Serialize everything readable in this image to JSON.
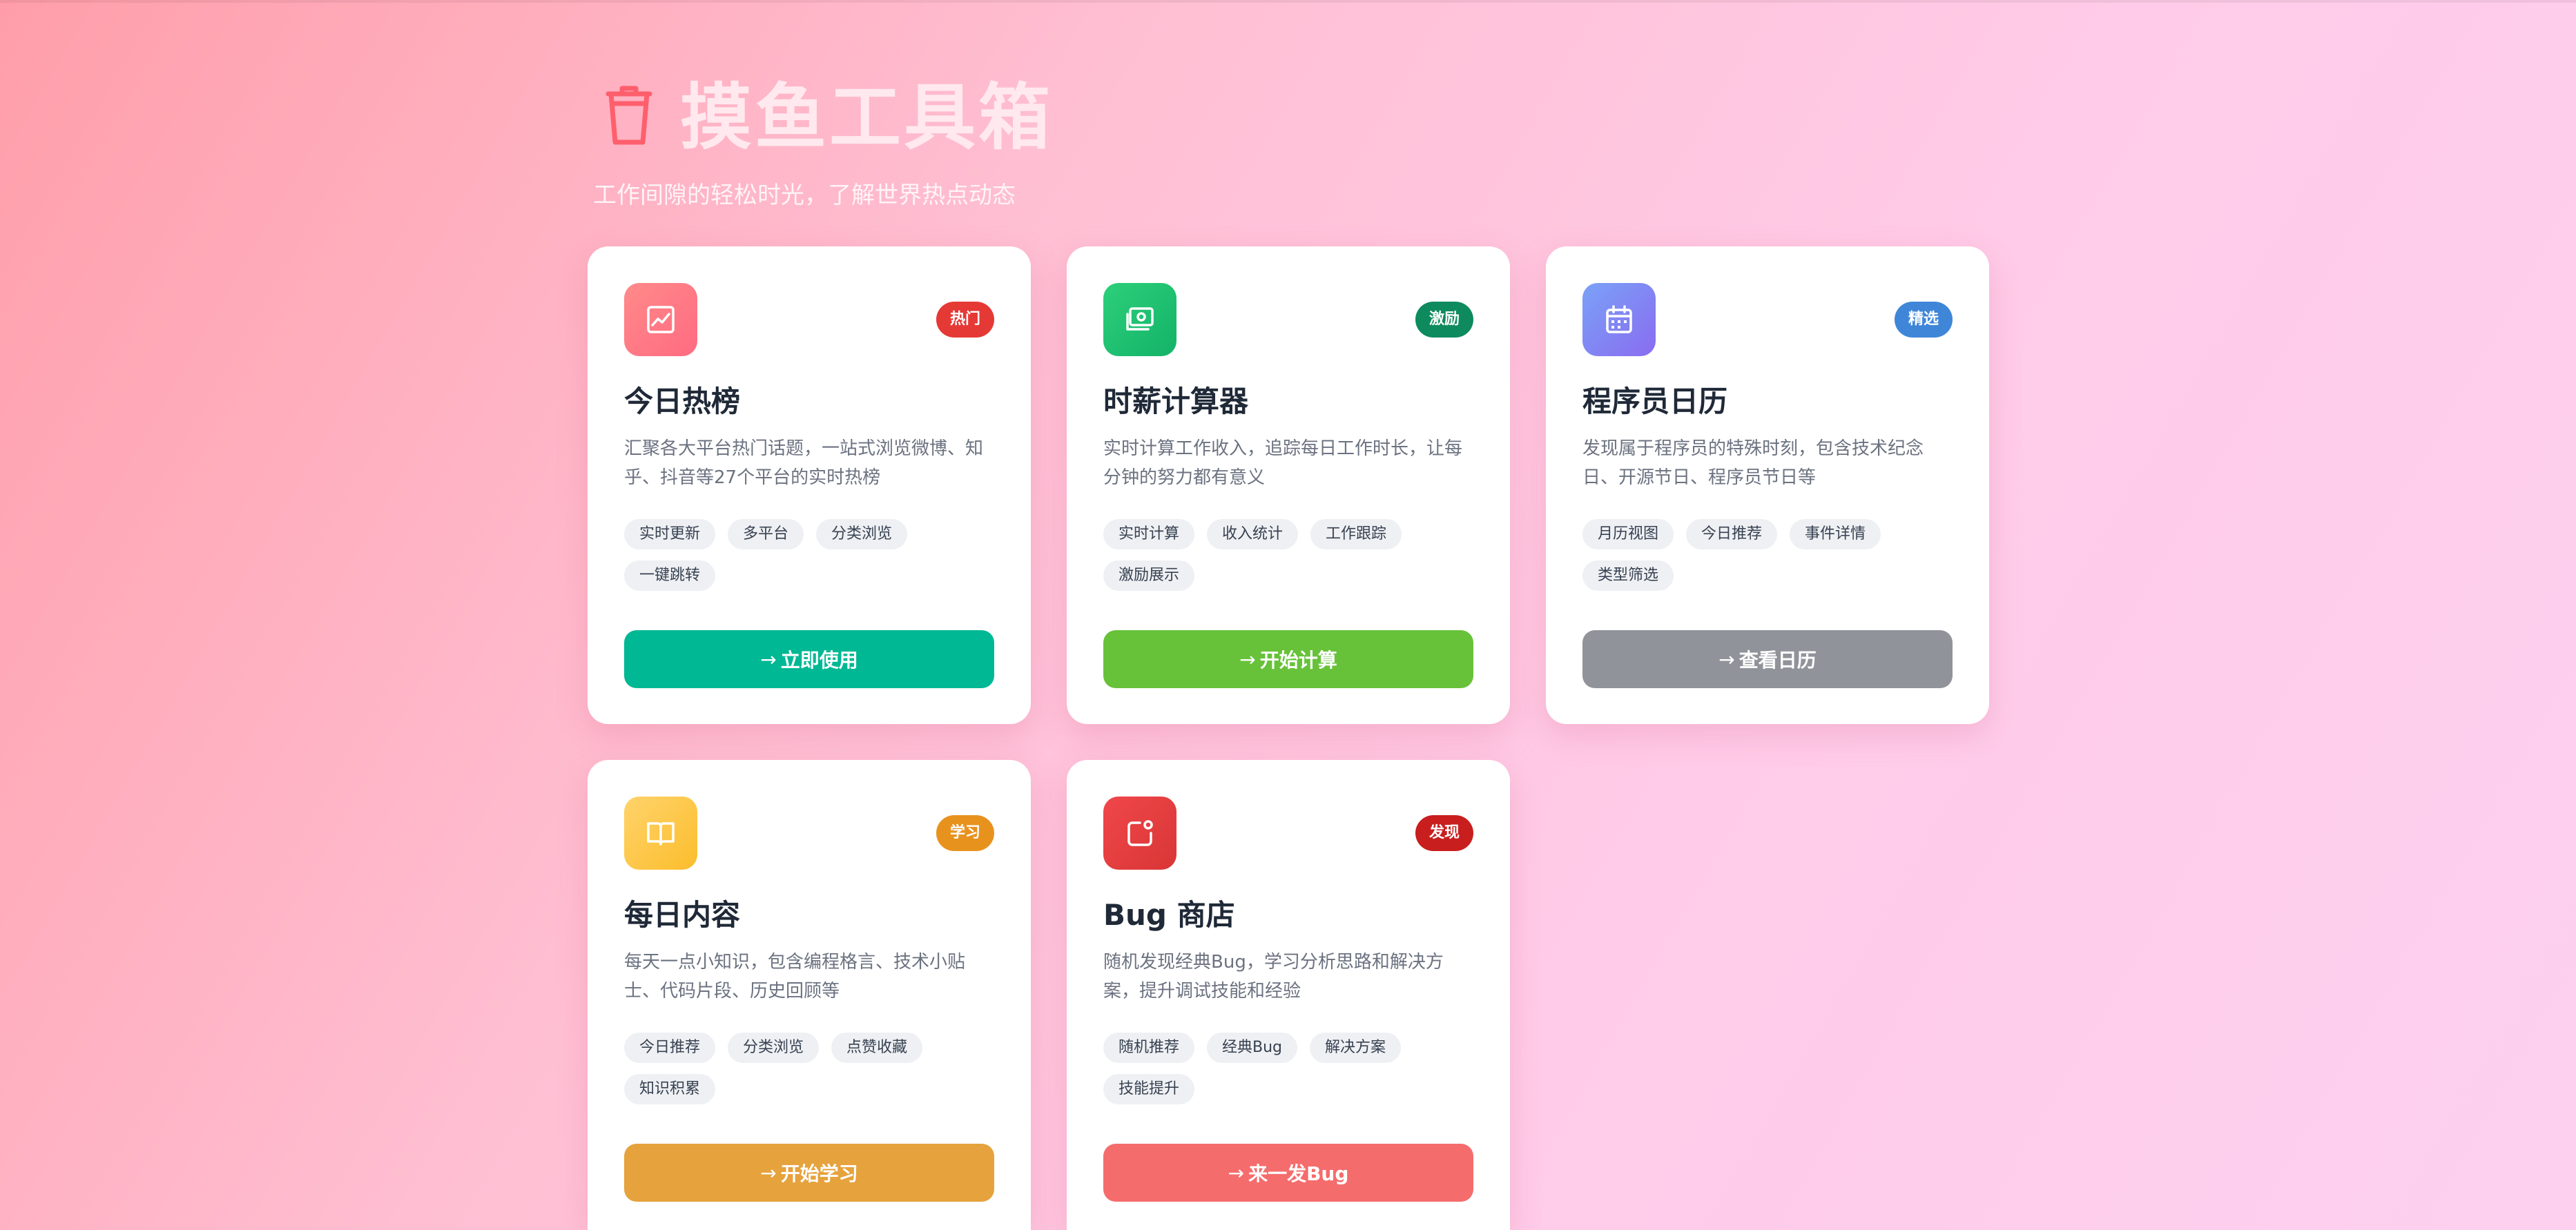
{
  "header": {
    "title": "摸鱼工具箱",
    "subtitle": "工作间隙的轻松时光，了解世界热点动态",
    "logo_icon": "cup-icon",
    "accent_color": "#ff5f6d"
  },
  "cards": [
    {
      "icon": "trending-chart-icon",
      "icon_color": "#ff7b7b",
      "badge": "热门",
      "badge_color": "#e53935",
      "title": "今日热榜",
      "description": "汇聚各大平台热门话题，一站式浏览微博、知乎、抖音等27个平台的实时热榜",
      "tags": [
        "实时更新",
        "多平台",
        "分类浏览",
        "一键跳转"
      ],
      "button_label": "立即使用",
      "button_color": "#00b894"
    },
    {
      "icon": "money-icon",
      "icon_color": "#1dc171",
      "badge": "激励",
      "badge_color": "#0e8a5f",
      "title": "时薪计算器",
      "description": "实时计算工作收入，追踪每日工作时长，让每分钟的努力都有意义",
      "tags": [
        "实时计算",
        "收入统计",
        "工作跟踪",
        "激励展示"
      ],
      "button_label": "开始计算",
      "button_color": "#67c23a"
    },
    {
      "icon": "calendar-icon",
      "icon_color": "#7f7cf0",
      "badge": "精选",
      "badge_color": "#3f86d8",
      "title": "程序员日历",
      "description": "发现属于程序员的特殊时刻，包含技术纪念日、开源节日、程序员节日等",
      "tags": [
        "月历视图",
        "今日推荐",
        "事件详情",
        "类型筛选"
      ],
      "button_label": "查看日历",
      "button_color": "#909399"
    },
    {
      "icon": "book-icon",
      "icon_color": "#fcc63d",
      "badge": "学习",
      "badge_color": "#e8921e",
      "title": "每日内容",
      "description": "每天一点小知识，包含编程格言、技术小贴士、代码片段、历史回顾等",
      "tags": [
        "今日推荐",
        "分类浏览",
        "点赞收藏",
        "知识积累"
      ],
      "button_label": "开始学习",
      "button_color": "#e6a23c"
    },
    {
      "icon": "notification-square-icon",
      "icon_color": "#e53e3e",
      "badge": "发现",
      "badge_color": "#c81e1e",
      "title": "Bug 商店",
      "description": "随机发现经典Bug，学习分析思路和解决方案，提升调试技能和经验",
      "tags": [
        "随机推荐",
        "经典Bug",
        "解决方案",
        "技能提升"
      ],
      "button_label": "来一发Bug",
      "button_color": "#f56c6c"
    }
  ]
}
